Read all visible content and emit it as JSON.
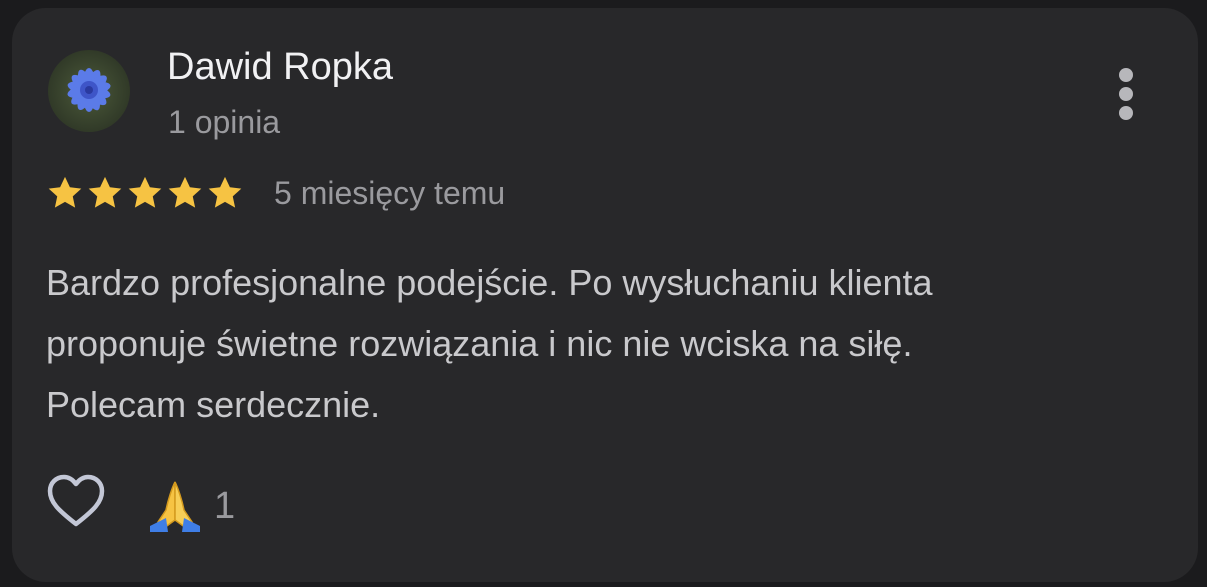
{
  "review": {
    "author": {
      "name": "Dawid Ropka",
      "meta": "1 opinia",
      "avatar_icon": "chicory-flower-photo"
    },
    "rating": {
      "stars": 5,
      "max": 5,
      "star_color": "#f6c343"
    },
    "date": "5 miesięcy temu",
    "text_lines": [
      "Bardzo profesjonalne podejście. Po wysłuchaniu klienta",
      "proponuje świetne rozwiązania i nic nie wciska na siłę.",
      "Polecam serdecznie."
    ],
    "actions": {
      "more_icon": "more-vertical-icon",
      "like_icon": "heart-outline-icon",
      "reaction_icon": "folded-hands-emoji",
      "reaction_count": "1"
    }
  }
}
